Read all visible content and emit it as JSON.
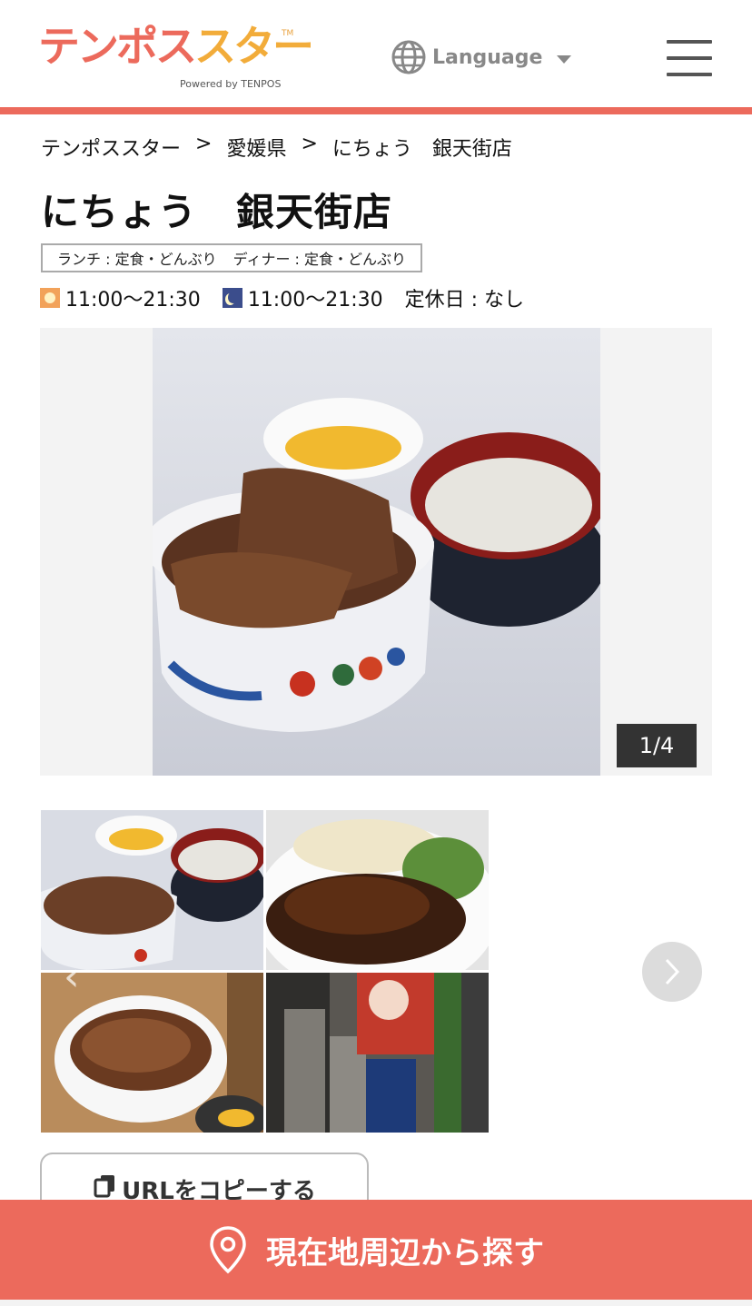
{
  "header": {
    "logo_part1": "テンポス",
    "logo_part2": "スター",
    "logo_tm": "TM",
    "logo_sub": "Powered by TENPOS",
    "language_label": "Language"
  },
  "breadcrumb": [
    "テンポススター",
    "愛媛県",
    "にちょう　銀天街店"
  ],
  "breadcrumb_sep": ">",
  "shop": {
    "title": "にちょう　銀天街店",
    "lunch_genre": "ランチ : 定食・どんぶり",
    "dinner_genre": "ディナー : 定食・どんぶり",
    "lunch_hours": "11:00〜21:30",
    "dinner_hours": "11:00〜21:30",
    "closed_day": "定休日 : なし"
  },
  "gallery": {
    "counter": "1/4"
  },
  "actions": {
    "copy_url": "URLをコピーする",
    "search_nearby": "現在地周辺から探す"
  },
  "colors": {
    "brand_red": "#ec6a5c",
    "brand_orange": "#f2ac3a"
  }
}
